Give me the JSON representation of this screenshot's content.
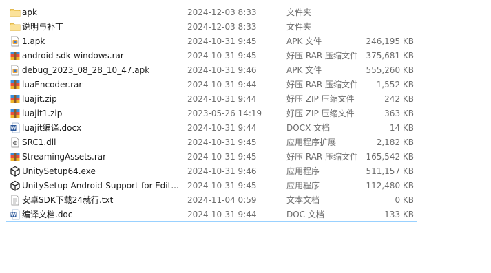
{
  "files": [
    {
      "name": "apk",
      "date": "2024-12-03 8:33",
      "type": "文件夹",
      "size": "",
      "icon": "folder-icon"
    },
    {
      "name": "说明与补丁",
      "date": "2024-12-03 8:33",
      "type": "文件夹",
      "size": "",
      "icon": "folder-icon"
    },
    {
      "name": "1.apk",
      "date": "2024-10-31 9:45",
      "type": "APK 文件",
      "size": "246,195 KB",
      "icon": "apk-file-icon"
    },
    {
      "name": "android-sdk-windows.rar",
      "date": "2024-10-31 9:45",
      "type": "好压 RAR 压缩文件",
      "size": "375,681 KB",
      "icon": "archive-file-icon"
    },
    {
      "name": "debug_2023_08_28_10_47.apk",
      "date": "2024-10-31 9:46",
      "type": "APK 文件",
      "size": "555,260 KB",
      "icon": "apk-file-icon"
    },
    {
      "name": "luaEncoder.rar",
      "date": "2024-10-31 9:44",
      "type": "好压 RAR 压缩文件",
      "size": "1,552 KB",
      "icon": "archive-file-icon"
    },
    {
      "name": "luajit.zip",
      "date": "2024-10-31 9:44",
      "type": "好压 ZIP 压缩文件",
      "size": "242 KB",
      "icon": "archive-file-icon"
    },
    {
      "name": "luajit1.zip",
      "date": "2023-05-26 14:19",
      "type": "好压 ZIP 压缩文件",
      "size": "363 KB",
      "icon": "archive-file-icon"
    },
    {
      "name": "luajit编译.docx",
      "date": "2024-10-31 9:44",
      "type": "DOCX 文档",
      "size": "14 KB",
      "icon": "word-document-icon"
    },
    {
      "name": "SRC1.dll",
      "date": "2024-10-31 9:45",
      "type": "应用程序扩展",
      "size": "2,182 KB",
      "icon": "dll-file-icon"
    },
    {
      "name": "StreamingAssets.rar",
      "date": "2024-10-31 9:45",
      "type": "好压 RAR 压缩文件",
      "size": "165,542 KB",
      "icon": "archive-file-icon"
    },
    {
      "name": "UnitySetup64.exe",
      "date": "2024-10-31 9:46",
      "type": "应用程序",
      "size": "511,157 KB",
      "icon": "unity-app-icon"
    },
    {
      "name": "UnitySetup-Android-Support-for-Edit...",
      "date": "2024-10-31 9:45",
      "type": "应用程序",
      "size": "112,480 KB",
      "icon": "unity-app-icon"
    },
    {
      "name": "安卓SDK下载24就行.txt",
      "date": "2024-11-04 0:59",
      "type": "文本文档",
      "size": "0 KB",
      "icon": "text-file-icon"
    },
    {
      "name": "编译文档.doc",
      "date": "2024-10-31 9:44",
      "type": "DOC 文档",
      "size": "133 KB",
      "icon": "word-document-icon"
    }
  ],
  "selected_index": 14,
  "colors": {
    "selection_border": "#99d1ff",
    "folder": "#f8d775",
    "word": "#2b579a",
    "unity": "#222222"
  }
}
